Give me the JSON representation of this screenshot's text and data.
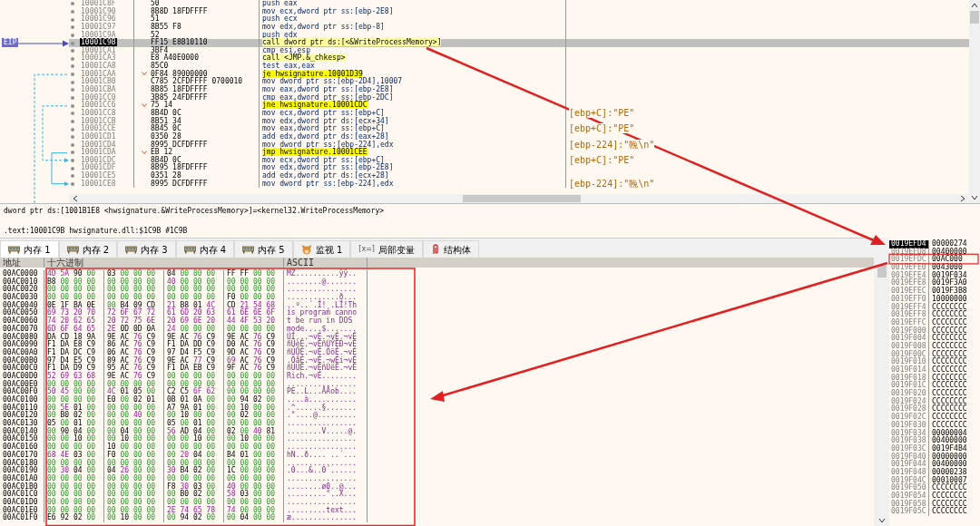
{
  "disassembly": {
    "eip_label": "EIP",
    "rows": [
      {
        "address": "10001C8F",
        "bytes": "50",
        "instruction": "push eax",
        "kind": "plain",
        "selected": false
      },
      {
        "address": "10001C90",
        "bytes": "8B8D 18FDFFFF",
        "instruction": "mov ecx,dword ptr ss:[ebp-2E8]",
        "kind": "plain",
        "selected": false
      },
      {
        "address": "10001C96",
        "bytes": "51",
        "instruction": "push ecx",
        "kind": "plain",
        "selected": false
      },
      {
        "address": "10001C97",
        "bytes": "8B55 F8",
        "instruction": "mov edx,dword ptr ss:[ebp-8]",
        "kind": "plain",
        "selected": false
      },
      {
        "address": "10001C9A",
        "bytes": "52",
        "instruction": "push edx",
        "kind": "plain",
        "selected": false
      },
      {
        "address": "10001C9B",
        "bytes": "FF15 E8B10110",
        "instruction": "call dword ptr ds:[<&WriteProcessMemory>]",
        "kind": "call",
        "selected": true
      },
      {
        "address": "10001CA1",
        "bytes": "3BF4",
        "instruction": "cmp esi,esp",
        "kind": "plain",
        "selected": false
      },
      {
        "address": "10001CA3",
        "bytes": "E8 A40E0000",
        "instruction": "call <JMP.&_chkesp>",
        "kind": "call",
        "selected": false
      },
      {
        "address": "10001CA8",
        "bytes": "85C0",
        "instruction": "test eax,eax",
        "kind": "plain",
        "selected": false
      },
      {
        "address": "10001CAA",
        "bytes": "0F84 89000000",
        "instruction": "je hwsignature.10001D39",
        "kind": "jump",
        "selected": false
      },
      {
        "address": "10001CB0",
        "bytes": "C785 2CFDFFFF 0700010",
        "instruction": "mov dword ptr ss:[ebp-2D4],10007",
        "kind": "plain",
        "selected": false
      },
      {
        "address": "10001CBA",
        "bytes": "8B85 18FDFFFF",
        "instruction": "mov eax,dword ptr ss:[ebp-2E8]",
        "kind": "plain",
        "selected": false
      },
      {
        "address": "10001CC0",
        "bytes": "3B85 24FDFFFF",
        "instruction": "cmp eax,dword ptr ss:[ebp-2DC]",
        "kind": "plain",
        "selected": false
      },
      {
        "address": "10001CC6",
        "bytes": "75 14",
        "instruction": "jne hwsignature.10001CDC",
        "kind": "jump",
        "selected": false
      },
      {
        "address": "10001CC8",
        "bytes": "8B4D 0C",
        "instruction": "mov ecx,dword ptr ss:[ebp+C]",
        "kind": "plain",
        "selected": false,
        "comment": "[ebp+C]:\"PE\""
      },
      {
        "address": "10001CCB",
        "bytes": "8B51 34",
        "instruction": "mov edx,dword ptr ds:[ecx+34]",
        "kind": "plain",
        "selected": false
      },
      {
        "address": "10001CCE",
        "bytes": "8B45 0C",
        "instruction": "mov eax,dword ptr ss:[ebp+C]",
        "kind": "plain",
        "selected": false,
        "comment": "[ebp+C]:\"PE\""
      },
      {
        "address": "10001CD1",
        "bytes": "0350 28",
        "instruction": "add edx,dword ptr ds:[eax+28]",
        "kind": "plain",
        "selected": false
      },
      {
        "address": "10001CD4",
        "bytes": "8995 DCFDFFFF",
        "instruction": "mov dword ptr ss:[ebp-224],edx",
        "kind": "plain",
        "selected": false,
        "comment": "[ebp-224]:\"鞔\\n\""
      },
      {
        "address": "10001CDA",
        "bytes": "EB 12",
        "instruction": "jmp hwsignature.10001CEE",
        "kind": "jump",
        "selected": false
      },
      {
        "address": "10001CDC",
        "bytes": "8B4D 0C",
        "instruction": "mov ecx,dword ptr ss:[ebp+C]",
        "kind": "plain",
        "selected": false,
        "comment": "[ebp+C]:\"PE\""
      },
      {
        "address": "10001CDF",
        "bytes": "8B95 18FDFFFF",
        "instruction": "mov edx,dword ptr ss:[ebp-2E8]",
        "kind": "plain",
        "selected": false
      },
      {
        "address": "10001CE5",
        "bytes": "0351 28",
        "instruction": "add edx,dword ptr ds:[ecx+28]",
        "kind": "plain",
        "selected": false
      },
      {
        "address": "10001CE8",
        "bytes": "8995 DCFDFFFF",
        "instruction": "mov dword ptr ss:[ebp-224],edx",
        "kind": "plain",
        "selected": false,
        "comment": "[ebp-224]:\"鞔\\n\""
      }
    ]
  },
  "info": {
    "lines": [
      "dword ptr ds:[1001B1E8 <hwsignature.&WriteProcessMemory>]=<kernel32.WriteProcessMemory>",
      ".text:10001C9B hwsignature.dll:$1C9B #1C9B"
    ]
  },
  "tabs": [
    {
      "label": "内存 1",
      "kind": "memory",
      "selected": true
    },
    {
      "label": "内存 2",
      "kind": "memory",
      "selected": false
    },
    {
      "label": "内存 3",
      "kind": "memory",
      "selected": false
    },
    {
      "label": "内存 4",
      "kind": "memory",
      "selected": false
    },
    {
      "label": "内存 5",
      "kind": "memory",
      "selected": false
    },
    {
      "label": "监视 1",
      "kind": "watch",
      "selected": false
    },
    {
      "label": "局部变量",
      "kind": "locals",
      "icon_text": "[x=]",
      "selected": false
    },
    {
      "label": "结构体",
      "kind": "struct",
      "selected": false
    }
  ],
  "dump": {
    "columns": {
      "address": "地址",
      "hex": "十六进制",
      "ascii": "ASCII"
    },
    "rows": [
      {
        "address": "00AC0000",
        "bytes": "4D 5A 90 00 03 00 00 00 04 00 00 00 FF FF 00 00",
        "ascii": "MZ..........ÿÿ.."
      },
      {
        "address": "00AC0010",
        "bytes": "B8 00 00 00 00 00 00 00 40 00 00 00 00 00 00 00",
        "ascii": "........@......."
      },
      {
        "address": "00AC0020",
        "bytes": "00 00 00 00 00 00 00 00 00 00 00 00 00 00 00 00",
        "ascii": "................"
      },
      {
        "address": "00AC0030",
        "bytes": "00 00 00 00 00 00 00 00 00 00 00 00 F0 00 00 00",
        "ascii": "............ð..."
      },
      {
        "address": "00AC0040",
        "bytes": "0E 1F BA 0E 00 B4 09 CD 21 B8 01 4C CD 21 54 68",
        "ascii": "..º..´.Í!¸.LÍ!Th"
      },
      {
        "address": "00AC0050",
        "bytes": "69 73 20 70 72 6F 67 72 61 6D 20 63 61 6E 6E 6F",
        "ascii": "is program canno"
      },
      {
        "address": "00AC0060",
        "bytes": "74 20 62 65 20 72 75 6E 20 69 6E 20 44 4F 53 20",
        "ascii": "t be run in DOS "
      },
      {
        "address": "00AC0070",
        "bytes": "6D 6F 64 65 2E 0D 0D 0A 24 00 00 00 00 00 00 00",
        "ascii": "mode....$......."
      },
      {
        "address": "00AC0080",
        "bytes": "DA CD 18 9A 9E AC 76 C9 9E AC 76 C9 9E AC 76 C9",
        "ascii": "ÚÍ...¬vÉ.¬vÉ.¬vÉ"
      },
      {
        "address": "00AC0090",
        "bytes": "F1 DA E8 C9 86 AC 76 C9 F1 DA DD C9 D0 AC 76 C9",
        "ascii": "ñÚèÉ.¬vÉñÚÝÉÐ¬vÉ"
      },
      {
        "address": "00AC00A0",
        "bytes": "F1 DA DC C9 06 AC 76 C9 97 D4 F5 C9 9D AC 76 C9",
        "ascii": "ñÚÜÉ.¬vÉ.ÔõÉ.¬vÉ"
      },
      {
        "address": "00AC00B0",
        "bytes": "97 D4 E5 C9 89 AC 76 C9 9E AC 77 C9 69 AC 76 C9",
        "ascii": ".ÔåÉ.¬vÉ.¬wÉi¬vÉ"
      },
      {
        "address": "00AC00C0",
        "bytes": "F1 DA D9 C9 95 AC 76 C9 F1 DA EB C9 9F AC 76 C9",
        "ascii": "ñÚÙÉ.¬vÉñÚëÉ.¬vÉ"
      },
      {
        "address": "00AC00D0",
        "bytes": "52 69 63 68 9E AC 76 C9 00 00 00 00 00 00 00 00",
        "ascii": "Rich.¬vÉ........"
      },
      {
        "address": "00AC00E0",
        "bytes": "00 00 00 00 00 00 00 00 00 00 00 00 00 00 00 00",
        "ascii": "................"
      },
      {
        "address": "00AC00F0",
        "bytes": "50 45 00 00 4C 01 05 00 C2 C5 6F 62 00 00 00 00",
        "ascii": "PE..L...ÂÅob...."
      },
      {
        "address": "00AC0100",
        "bytes": "00 00 00 00 E0 00 02 01 0B 01 0A 00 00 94 02 00",
        "ascii": "....à..........."
      },
      {
        "address": "00AC0110",
        "bytes": "00 5E 01 00 00 00 00 00 A7 9A 01 00 00 10 00 00",
        "ascii": ".^......§......."
      },
      {
        "address": "00AC0120",
        "bytes": "00 B0 02 00 00 00 40 00 00 10 00 00 00 02 00 00",
        "ascii": ".°....@........."
      },
      {
        "address": "00AC0130",
        "bytes": "05 00 01 00 00 00 00 00 05 00 01 00 00 00 00 00",
        "ascii": "................"
      },
      {
        "address": "00AC0140",
        "bytes": "00 90 04 00 00 04 00 00 56 AD 04 00 02 00 40 81",
        "ascii": "........V.....@."
      },
      {
        "address": "00AC0150",
        "bytes": "00 00 10 00 00 10 00 00 00 00 10 00 00 10 00 00",
        "ascii": "................"
      },
      {
        "address": "00AC0160",
        "bytes": "00 00 00 00 10 00 00 00 00 00 00 00 00 00 00 00",
        "ascii": "................"
      },
      {
        "address": "00AC0170",
        "bytes": "68 4E 03 00 F0 00 00 00 00 20 04 00 B4 01 00 00",
        "ascii": "hN..ð.... ..´..."
      },
      {
        "address": "00AC0180",
        "bytes": "00 00 00 00 00 00 00 00 00 00 00 00 00 00 00 00",
        "ascii": "................"
      },
      {
        "address": "00AC0190",
        "bytes": "00 30 04 00 04 26 00 00 30 B4 02 00 1C 00 00 00",
        "ascii": ".0...&..0´......"
      },
      {
        "address": "00AC01A0",
        "bytes": "00 00 00 00 00 00 00 00 00 00 00 00 00 00 00 00",
        "ascii": "................"
      },
      {
        "address": "00AC01B0",
        "bytes": "00 00 00 00 00 00 00 00 F8 30 03 00 40 00 00 00",
        "ascii": "........ø0..@..."
      },
      {
        "address": "00AC01C0",
        "bytes": "00 00 00 00 00 00 00 00 00 B0 02 00 58 03 00 00",
        "ascii": ".........°..X..."
      },
      {
        "address": "00AC01D0",
        "bytes": "00 00 00 00 00 00 00 00 00 00 00 00 00 00 00 00",
        "ascii": "................"
      },
      {
        "address": "00AC01E0",
        "bytes": "00 00 00 00 00 00 00 00 2E 74 65 78 74 00 00 00",
        "ascii": ".........text..."
      },
      {
        "address": "00AC01F0",
        "bytes": "E6 92 02 00 00 10 00 00 00 94 02 00 00 04 00 00",
        "ascii": "æ..............."
      }
    ]
  },
  "stack": {
    "rows": [
      {
        "address": "0019EFD4",
        "value": "00000274",
        "selected": true
      },
      {
        "address": "0019EFD8",
        "value": "00400000",
        "selected": false
      },
      {
        "address": "0019EFDC",
        "value": "00AC000",
        "selected": false
      },
      {
        "address": "0019EFE0",
        "value": "0043000",
        "selected": false
      },
      {
        "address": "0019EFE4",
        "value": "0019F034",
        "selected": false
      },
      {
        "address": "0019EFE8",
        "value": "0019F3A0",
        "selected": false
      },
      {
        "address": "0019EFEC",
        "value": "0019F3B8",
        "selected": false
      },
      {
        "address": "0019EFF0",
        "value": "10000000",
        "selected": false
      },
      {
        "address": "0019EFF4",
        "value": "CCCCCCCC",
        "selected": false
      },
      {
        "address": "0019EFF8",
        "value": "CCCCCCCC",
        "selected": false
      },
      {
        "address": "0019EFFC",
        "value": "CCCCCCCC",
        "selected": false
      },
      {
        "address": "0019F000",
        "value": "CCCCCCCC",
        "selected": false
      },
      {
        "address": "0019F004",
        "value": "CCCCCCCC",
        "selected": false
      },
      {
        "address": "0019F008",
        "value": "CCCCCCCC",
        "selected": false
      },
      {
        "address": "0019F00C",
        "value": "CCCCCCCC",
        "selected": false
      },
      {
        "address": "0019F010",
        "value": "CCCCCCCC",
        "selected": false
      },
      {
        "address": "0019F014",
        "value": "CCCCCCCC",
        "selected": false
      },
      {
        "address": "0019F018",
        "value": "CCCCCCCC",
        "selected": false
      },
      {
        "address": "0019F01C",
        "value": "CCCCCCCC",
        "selected": false
      },
      {
        "address": "0019F020",
        "value": "CCCCCCCC",
        "selected": false
      },
      {
        "address": "0019F024",
        "value": "CCCCCCCC",
        "selected": false
      },
      {
        "address": "0019F028",
        "value": "CCCCCCCC",
        "selected": false
      },
      {
        "address": "0019F02C",
        "value": "CCCCCCCC",
        "selected": false
      },
      {
        "address": "0019F030",
        "value": "CCCCCCCC",
        "selected": false
      },
      {
        "address": "0019F034",
        "value": "00000004",
        "selected": false
      },
      {
        "address": "0019F038",
        "value": "00400000",
        "selected": false
      },
      {
        "address": "0019F03C",
        "value": "0019F4B4",
        "selected": false
      },
      {
        "address": "0019F040",
        "value": "00000000",
        "selected": false
      },
      {
        "address": "0019F044",
        "value": "00400000",
        "selected": false
      },
      {
        "address": "0019F048",
        "value": "00000238",
        "selected": false
      },
      {
        "address": "0019F04C",
        "value": "00010007",
        "selected": false
      },
      {
        "address": "0019F050",
        "value": "CCCCCCCC",
        "selected": false
      },
      {
        "address": "0019F054",
        "value": "CCCCCCCC",
        "selected": false
      },
      {
        "address": "0019F058",
        "value": "CCCCCCCC",
        "selected": false
      },
      {
        "address": "0019F05C",
        "value": "CCCCCCCC",
        "selected": false
      }
    ]
  }
}
